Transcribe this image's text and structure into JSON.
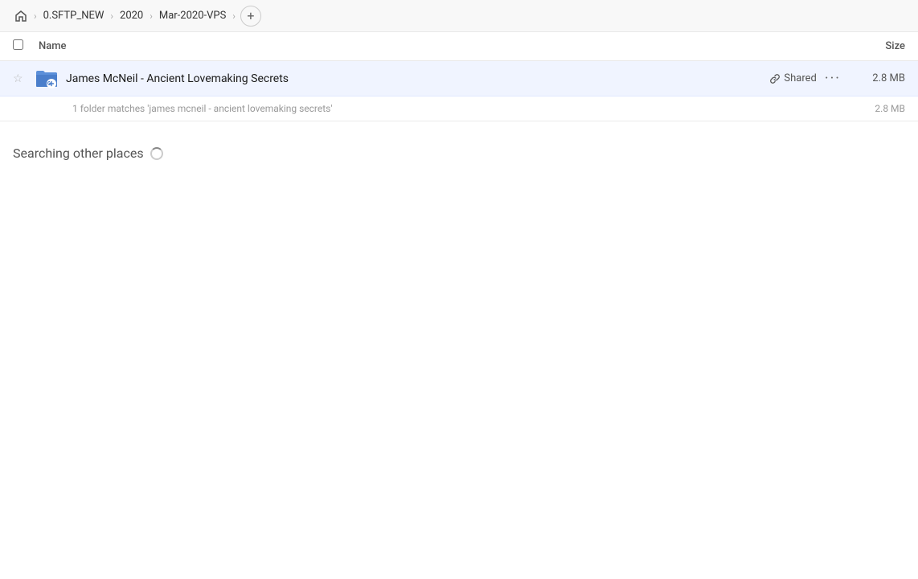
{
  "breadcrumb": {
    "home_label": "Home",
    "items": [
      {
        "label": "0.SFTP_NEW"
      },
      {
        "label": "2020"
      },
      {
        "label": "Mar-2020-VPS"
      }
    ],
    "add_label": "+"
  },
  "columns": {
    "name_label": "Name",
    "size_label": "Size"
  },
  "file_row": {
    "name": "James McNeil - Ancient Lovemaking Secrets",
    "shared_label": "Shared",
    "size": "2.8 MB"
  },
  "match_info": {
    "text": "1 folder matches 'james mcneil - ancient lovemaking secrets'",
    "size": "2.8 MB"
  },
  "searching": {
    "label": "Searching other places"
  }
}
